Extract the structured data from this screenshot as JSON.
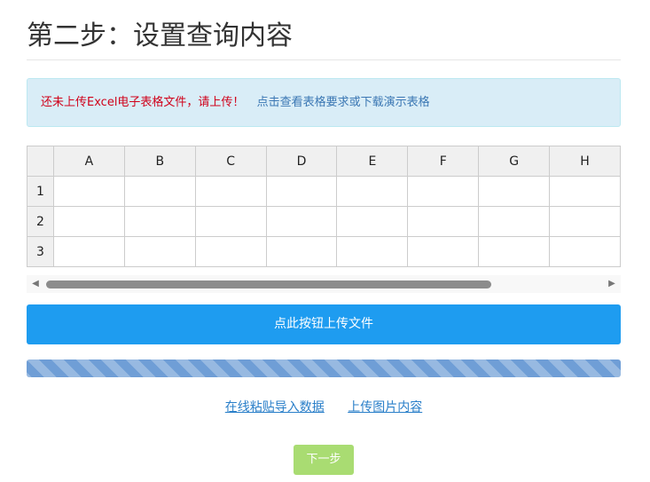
{
  "header": {
    "title": "第二步：设置查询内容"
  },
  "alert": {
    "warning": "还未上传Excel电子表格文件，请上传！",
    "link": "点击查看表格要求或下载演示表格"
  },
  "sheet": {
    "columns": [
      "A",
      "B",
      "C",
      "D",
      "E",
      "F",
      "G",
      "H"
    ],
    "rows": [
      "1",
      "2",
      "3"
    ]
  },
  "scrollbar": {
    "left_icon": "triangle-left-icon",
    "right_icon": "triangle-right-icon"
  },
  "upload": {
    "label": "点此按钮上传文件"
  },
  "links": {
    "paste": "在线粘贴导入数据",
    "image": "上传图片内容"
  },
  "next": {
    "label": "下一步"
  },
  "colors": {
    "primary": "#1e9cf0",
    "warning_text": "#d0021b",
    "info_bg": "#d9edf7",
    "progress": "#6f9ed6",
    "next_bg": "#a9dc72"
  }
}
